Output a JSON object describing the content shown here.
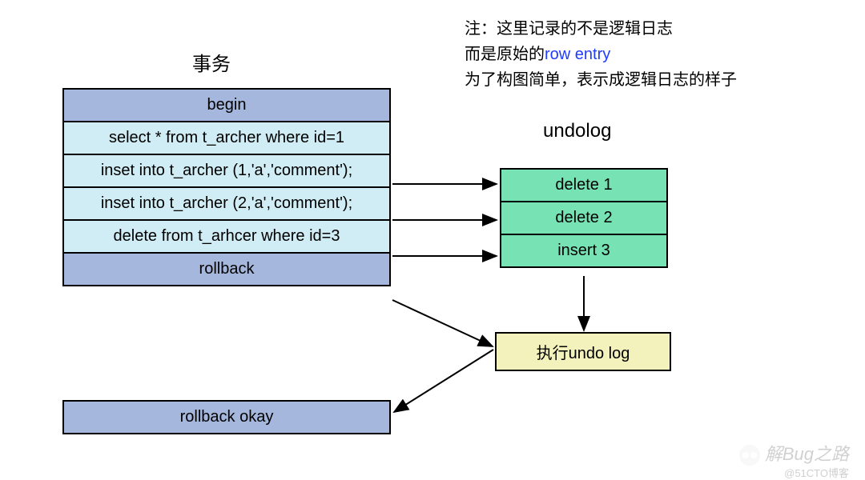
{
  "titles": {
    "transaction": "事务",
    "undolog": "undolog"
  },
  "note": {
    "line1_prefix": "注：这里记录的不是逻辑日志",
    "line2_prefix": "而是原始的",
    "line2_blue": "row entry",
    "line3": "为了构图简单，表示成逻辑日志的样子"
  },
  "transaction_rows": {
    "r0": "begin",
    "r1": "select * from t_archer where id=1",
    "r2": "inset into t_archer (1,'a','comment');",
    "r3": "inset into t_archer (2,'a','comment');",
    "r4": "delete from t_arhcer where id=3",
    "r5": "rollback"
  },
  "undolog_rows": {
    "u0": "delete 1",
    "u1": "delete 2",
    "u2": "insert 3"
  },
  "exec_label": "执行undo log",
  "result_label": "rollback okay",
  "watermark": "解Bug之路",
  "subwatermark": "@51CTO博客"
}
